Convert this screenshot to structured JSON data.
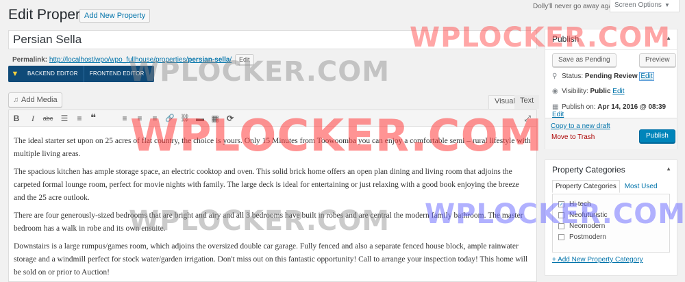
{
  "header": {
    "title": "Edit Property",
    "add_new_label": "Add New Property",
    "dolly_text": "Dolly'll never go away again",
    "screen_options_label": "Screen Options"
  },
  "post": {
    "title": "Persian Sella",
    "permalink_label": "Permalink:",
    "permalink_base": "http://localhost/wpo/wpo_fullhouse/properties/",
    "permalink_slug": "persian-sella",
    "permalink_trail": "/",
    "permalink_edit_label": "Edit"
  },
  "vc": {
    "backend_label": "BACKEND EDITOR",
    "frontend_label": "FRONTEND EDITOR"
  },
  "editor": {
    "add_media_label": "Add Media",
    "tab_visual": "Visual",
    "tab_text": "Text",
    "toolbar_icons": [
      "bold-icon",
      "italic-icon",
      "strikethrough-icon",
      "bulleted-list-icon",
      "numbered-list-icon",
      "blockquote-icon",
      "align-left-icon",
      "align-center-icon",
      "align-right-icon",
      "insert-link-icon",
      "remove-link-icon",
      "read-more-icon",
      "toolbar-toggle-icon",
      "shortcode-icon",
      "fullscreen-icon"
    ],
    "toolbar_glyphs": {
      "bold": "B",
      "italic": "I",
      "strike": "abc",
      "ul": "☰",
      "ol": "≡",
      "quote": "❝",
      "left": "≡",
      "center": "≡",
      "right": "≡",
      "link": "🔗",
      "unlink": "⛓",
      "more": "▬",
      "kitchen": "▦",
      "shortcode": "⟳",
      "fullscreen": "⤢"
    },
    "paragraphs": [
      "The ideal starter set upon on 25 acres of flat country, the choice is yours. Only 15 Minutes from Toowoomba you can enjoy a comfortable semi – rural lifestyle with multiple living areas.",
      "The spacious kitchen has ample storage space, an electric cooktop and oven. This solid brick home offers an open plan dining and living room that adjoins the carpeted formal lounge room, perfect for movie nights with family. The large deck is ideal for entertaining or just relaxing with a good book enjoying the breeze and the 25 acre outlook.",
      "There are four generously-sized bedrooms that are bright and airy and all 3 bedrooms have built in robes and are central the modern family bathroom. The master bedroom has a walk in robe and its own ensuite.",
      "Downstairs is a large rumpus/games room, which adjoins the oversized double car garage. Fully fenced and also a separate fenced house block, ample rainwater storage and a windmill perfect for stock water/garden irrigation. Don't miss out on this fantastic opportunity! Call to arrange your inspection today! This home will be sold on or prior to Auction!"
    ]
  },
  "publish": {
    "title": "Publish",
    "save_pending_label": "Save as Pending",
    "preview_label": "Preview",
    "status_label": "Status:",
    "status_value": "Pending Review",
    "status_edit": "Edit",
    "visibility_label": "Visibility:",
    "visibility_value": "Public",
    "visibility_edit": "Edit",
    "publish_on_label": "Publish on:",
    "publish_on_value": "Apr 14, 2016 @ 08:39",
    "publish_on_edit": "Edit",
    "copy_draft_label": "Copy to a new draft",
    "trash_label": "Move to Trash",
    "publish_label": "Publish"
  },
  "categories": {
    "title": "Property Categories",
    "tab_all": "Property Categories",
    "tab_used": "Most Used",
    "items": [
      {
        "label": "Hi-tech",
        "checked": true
      },
      {
        "label": "Neofuturistic",
        "checked": false
      },
      {
        "label": "Neomodern",
        "checked": false
      },
      {
        "label": "Postmodern",
        "checked": false
      }
    ],
    "add_new_label": "+ Add New Property Category"
  },
  "watermark": {
    "text": "WPLOCKER.COM"
  },
  "colors": {
    "link": "#0073aa",
    "primary_button": "#0085ba",
    "trash": "#a00",
    "vc_bar": "#0f4a78",
    "watermark_red": "#ff4d4d",
    "watermark_gray": "#9a9a9a",
    "watermark_blue": "#6f6fff"
  }
}
